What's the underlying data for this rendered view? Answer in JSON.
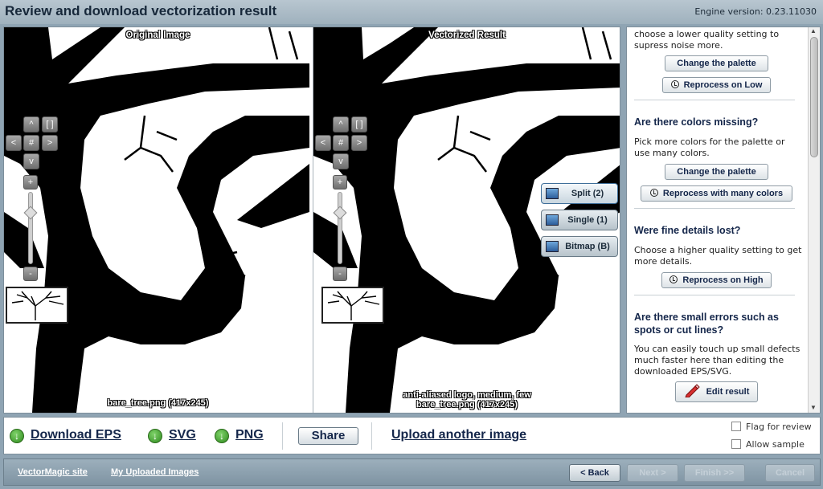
{
  "header": {
    "title": "Review and download vectorization result",
    "engine": "Engine version: 0.23.11030"
  },
  "viewer": {
    "left_label": "Original Image",
    "right_label": "Vectorized Result",
    "left_caption": "bare_tree.png  (417x245)",
    "right_caption_1": "anti-aliased logo, medium, few",
    "right_caption_2": "bare_tree.png  (417x245)",
    "nav": {
      "up": "^",
      "down": "v",
      "left": "<",
      "right": ">",
      "center": "#",
      "fit": "[ ]",
      "zoom_in": "+",
      "zoom_out": "-"
    },
    "views": [
      {
        "label": "Split (2)",
        "active": true
      },
      {
        "label": "Single (1)",
        "active": false
      },
      {
        "label": "Bitmap (B)",
        "active": false
      }
    ]
  },
  "sidebar": {
    "intro_text": "choose a lower quality setting to supress noise more.",
    "change_palette_1": "Change the palette",
    "reprocess_low": "Reprocess on Low",
    "colors_heading": "Are there colors missing?",
    "colors_text": "Pick more colors for the palette or use many colors.",
    "change_palette_2": "Change the palette",
    "reprocess_many": "Reprocess with many colors",
    "details_heading": "Were fine details lost?",
    "details_text": "Choose a higher quality setting to get more details.",
    "reprocess_high": "Reprocess on High",
    "errors_heading": "Are there small errors such as spots or cut lines?",
    "errors_text": "You can easily touch up small defects much faster here than editing the downloaded EPS/SVG.",
    "edit_result": "Edit result"
  },
  "downloads": {
    "eps": "Download EPS",
    "svg": "SVG",
    "png": "PNG",
    "share": "Share",
    "upload": "Upload another image",
    "flag": "Flag for review",
    "allow": "Allow sample"
  },
  "footer": {
    "site_link": "VectorMagic site",
    "uploads_link": "My Uploaded Images",
    "back": "< Back",
    "next": "Next >",
    "finish": "Finish >>",
    "cancel": "Cancel"
  }
}
